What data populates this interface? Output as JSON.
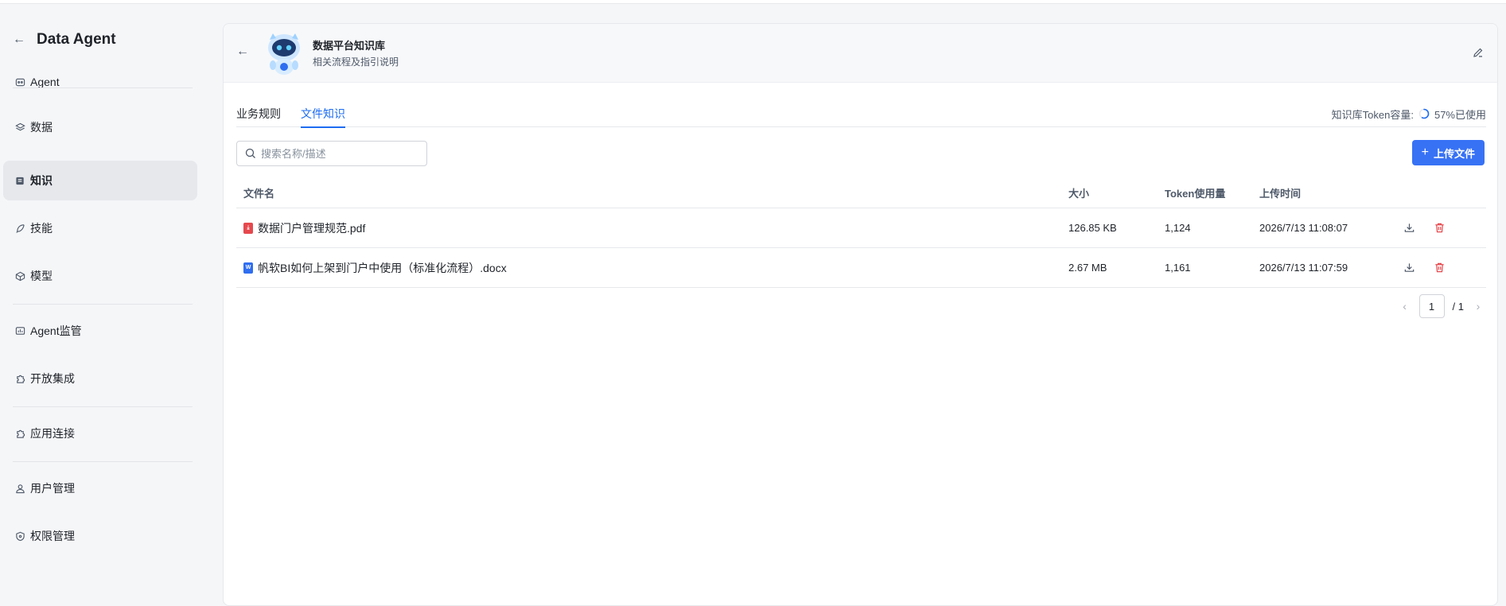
{
  "app": {
    "title": "Data Agent"
  },
  "sidebar": {
    "items": [
      {
        "label": "Agent",
        "icon": "robot-icon"
      },
      {
        "label": "数据",
        "icon": "layers-icon"
      },
      {
        "label": "知识",
        "icon": "book-icon",
        "active": true
      },
      {
        "label": "技能",
        "icon": "feather-icon"
      },
      {
        "label": "模型",
        "icon": "cube-icon"
      },
      {
        "label": "Agent监管",
        "icon": "monitor-icon"
      },
      {
        "label": "开放集成",
        "icon": "puzzle-icon"
      },
      {
        "label": "应用连接",
        "icon": "puzzle-icon"
      },
      {
        "label": "用户管理",
        "icon": "user-icon"
      },
      {
        "label": "权限管理",
        "icon": "shield-icon"
      }
    ]
  },
  "knowledge_base": {
    "title": "数据平台知识库",
    "description": "相关流程及指引说明"
  },
  "tabs": [
    {
      "label": "业务规则",
      "active": false
    },
    {
      "label": "文件知识",
      "active": true
    }
  ],
  "token": {
    "label": "知识库Token容量:",
    "usage_text": "57%已使用",
    "usage_fraction": 0.57
  },
  "search": {
    "placeholder": "搜索名称/描述",
    "value": ""
  },
  "upload": {
    "label": "上传文件"
  },
  "table": {
    "columns": [
      "文件名",
      "大小",
      "Token使用量",
      "上传时间",
      ""
    ],
    "rows": [
      {
        "name": "数据门户管理规范.pdf",
        "type": "pdf",
        "size": "126.85 KB",
        "tokens": "1,124",
        "time": "2026/7/13 11:08:07"
      },
      {
        "name": "帆软BI如何上架到门户中使用（标准化流程）.docx",
        "type": "docx",
        "size": "2.67 MB",
        "tokens": "1,161",
        "time": "2026/7/13 11:07:59"
      }
    ]
  },
  "pagination": {
    "current": "1",
    "total_text": "/ 1"
  },
  "colors": {
    "accent": "#1d6cf2",
    "button": "#3772f5",
    "danger": "#e5484d"
  }
}
